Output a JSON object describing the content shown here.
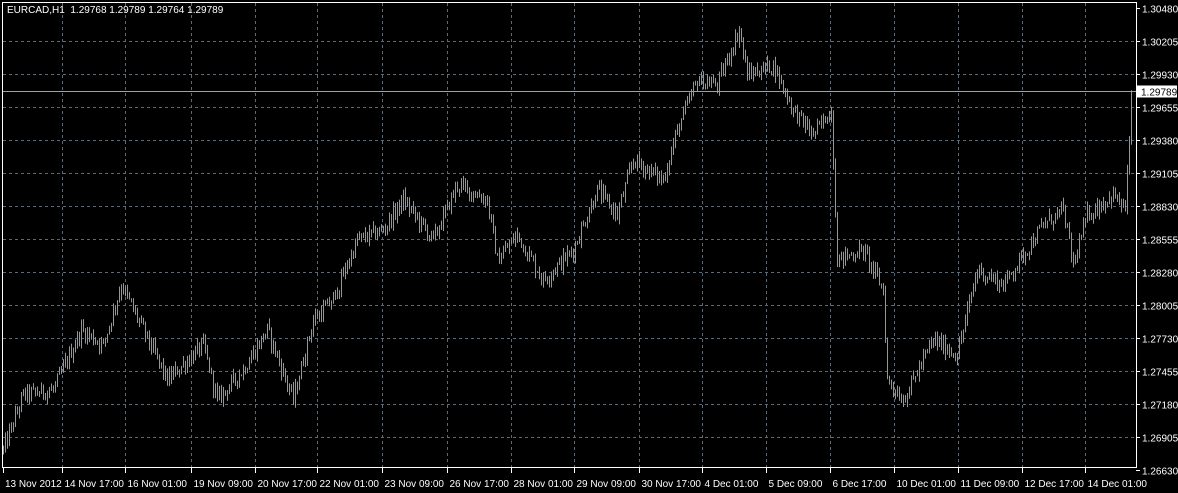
{
  "window": {
    "symbol_timeframe": "EURCAD,H1",
    "ohlc_readout": "1.29768 1.29789 1.29764 1.29789"
  },
  "colors": {
    "background": "#000000",
    "bars": "#00ff00",
    "grid": "#5a6878",
    "axis": "#ffffff",
    "bid_line": "#a0a0a0"
  },
  "chart_data": {
    "type": "ohlc",
    "symbol": "EURCAD",
    "timeframe": "H1",
    "current_price": 1.29789,
    "y_ticks": [
      "1.30480",
      "1.30205",
      "1.29930",
      "1.29655",
      "1.29380",
      "1.29105",
      "1.28830",
      "1.28555",
      "1.28280",
      "1.28005",
      "1.27730",
      "1.27455",
      "1.27180",
      "1.26905",
      "1.26630"
    ],
    "ylim": [
      1.2663,
      1.3048
    ],
    "x_ticks": [
      "13 Nov 2012",
      "14 Nov 17:00",
      "16 Nov 01:00",
      "19 Nov 09:00",
      "20 Nov 17:00",
      "22 Nov 01:00",
      "23 Nov 09:00",
      "26 Nov 17:00",
      "28 Nov 01:00",
      "29 Nov 09:00",
      "30 Nov 17:00",
      "4 Dec 01:00",
      "5 Dec 09:00",
      "6 Dec 17:00",
      "10 Dec 01:00",
      "11 Dec 09:00",
      "12 Dec 17:00",
      "14 Dec 01:00"
    ],
    "bar_count": 565,
    "approx_close_path": [
      [
        0,
        1.26797
      ],
      [
        10,
        1.27256
      ],
      [
        25,
        1.27298
      ],
      [
        39,
        1.27797
      ],
      [
        50,
        1.27673
      ],
      [
        59,
        1.28173
      ],
      [
        70,
        1.27797
      ],
      [
        82,
        1.27381
      ],
      [
        100,
        1.27673
      ],
      [
        107,
        1.27215
      ],
      [
        120,
        1.27465
      ],
      [
        132,
        1.27797
      ],
      [
        145,
        1.27215
      ],
      [
        155,
        1.27881
      ],
      [
        165,
        1.28048
      ],
      [
        177,
        1.28547
      ],
      [
        190,
        1.28631
      ],
      [
        200,
        1.28881
      ],
      [
        215,
        1.28547
      ],
      [
        227,
        1.29006
      ],
      [
        242,
        1.28881
      ],
      [
        247,
        1.28381
      ],
      [
        257,
        1.28589
      ],
      [
        270,
        1.28214
      ],
      [
        285,
        1.28464
      ],
      [
        297,
        1.28964
      ],
      [
        307,
        1.28756
      ],
      [
        315,
        1.29214
      ],
      [
        330,
        1.29047
      ],
      [
        337,
        1.29464
      ],
      [
        347,
        1.2988
      ],
      [
        357,
        1.29839
      ],
      [
        368,
        1.30297
      ],
      [
        372,
        1.29922
      ],
      [
        385,
        1.30005
      ],
      [
        395,
        1.2963
      ],
      [
        405,
        1.29422
      ],
      [
        414,
        1.2963
      ],
      [
        417,
        1.28381
      ],
      [
        430,
        1.28464
      ],
      [
        440,
        1.28131
      ],
      [
        442,
        1.27381
      ],
      [
        450,
        1.27215
      ],
      [
        465,
        1.27714
      ],
      [
        477,
        1.2759
      ],
      [
        487,
        1.28298
      ],
      [
        500,
        1.28173
      ],
      [
        510,
        1.28422
      ],
      [
        520,
        1.28672
      ],
      [
        530,
        1.28797
      ],
      [
        535,
        1.28339
      ],
      [
        542,
        1.28756
      ],
      [
        555,
        1.28922
      ],
      [
        561,
        1.28797
      ],
      [
        563,
        1.2938
      ],
      [
        564,
        1.29789
      ]
    ]
  }
}
